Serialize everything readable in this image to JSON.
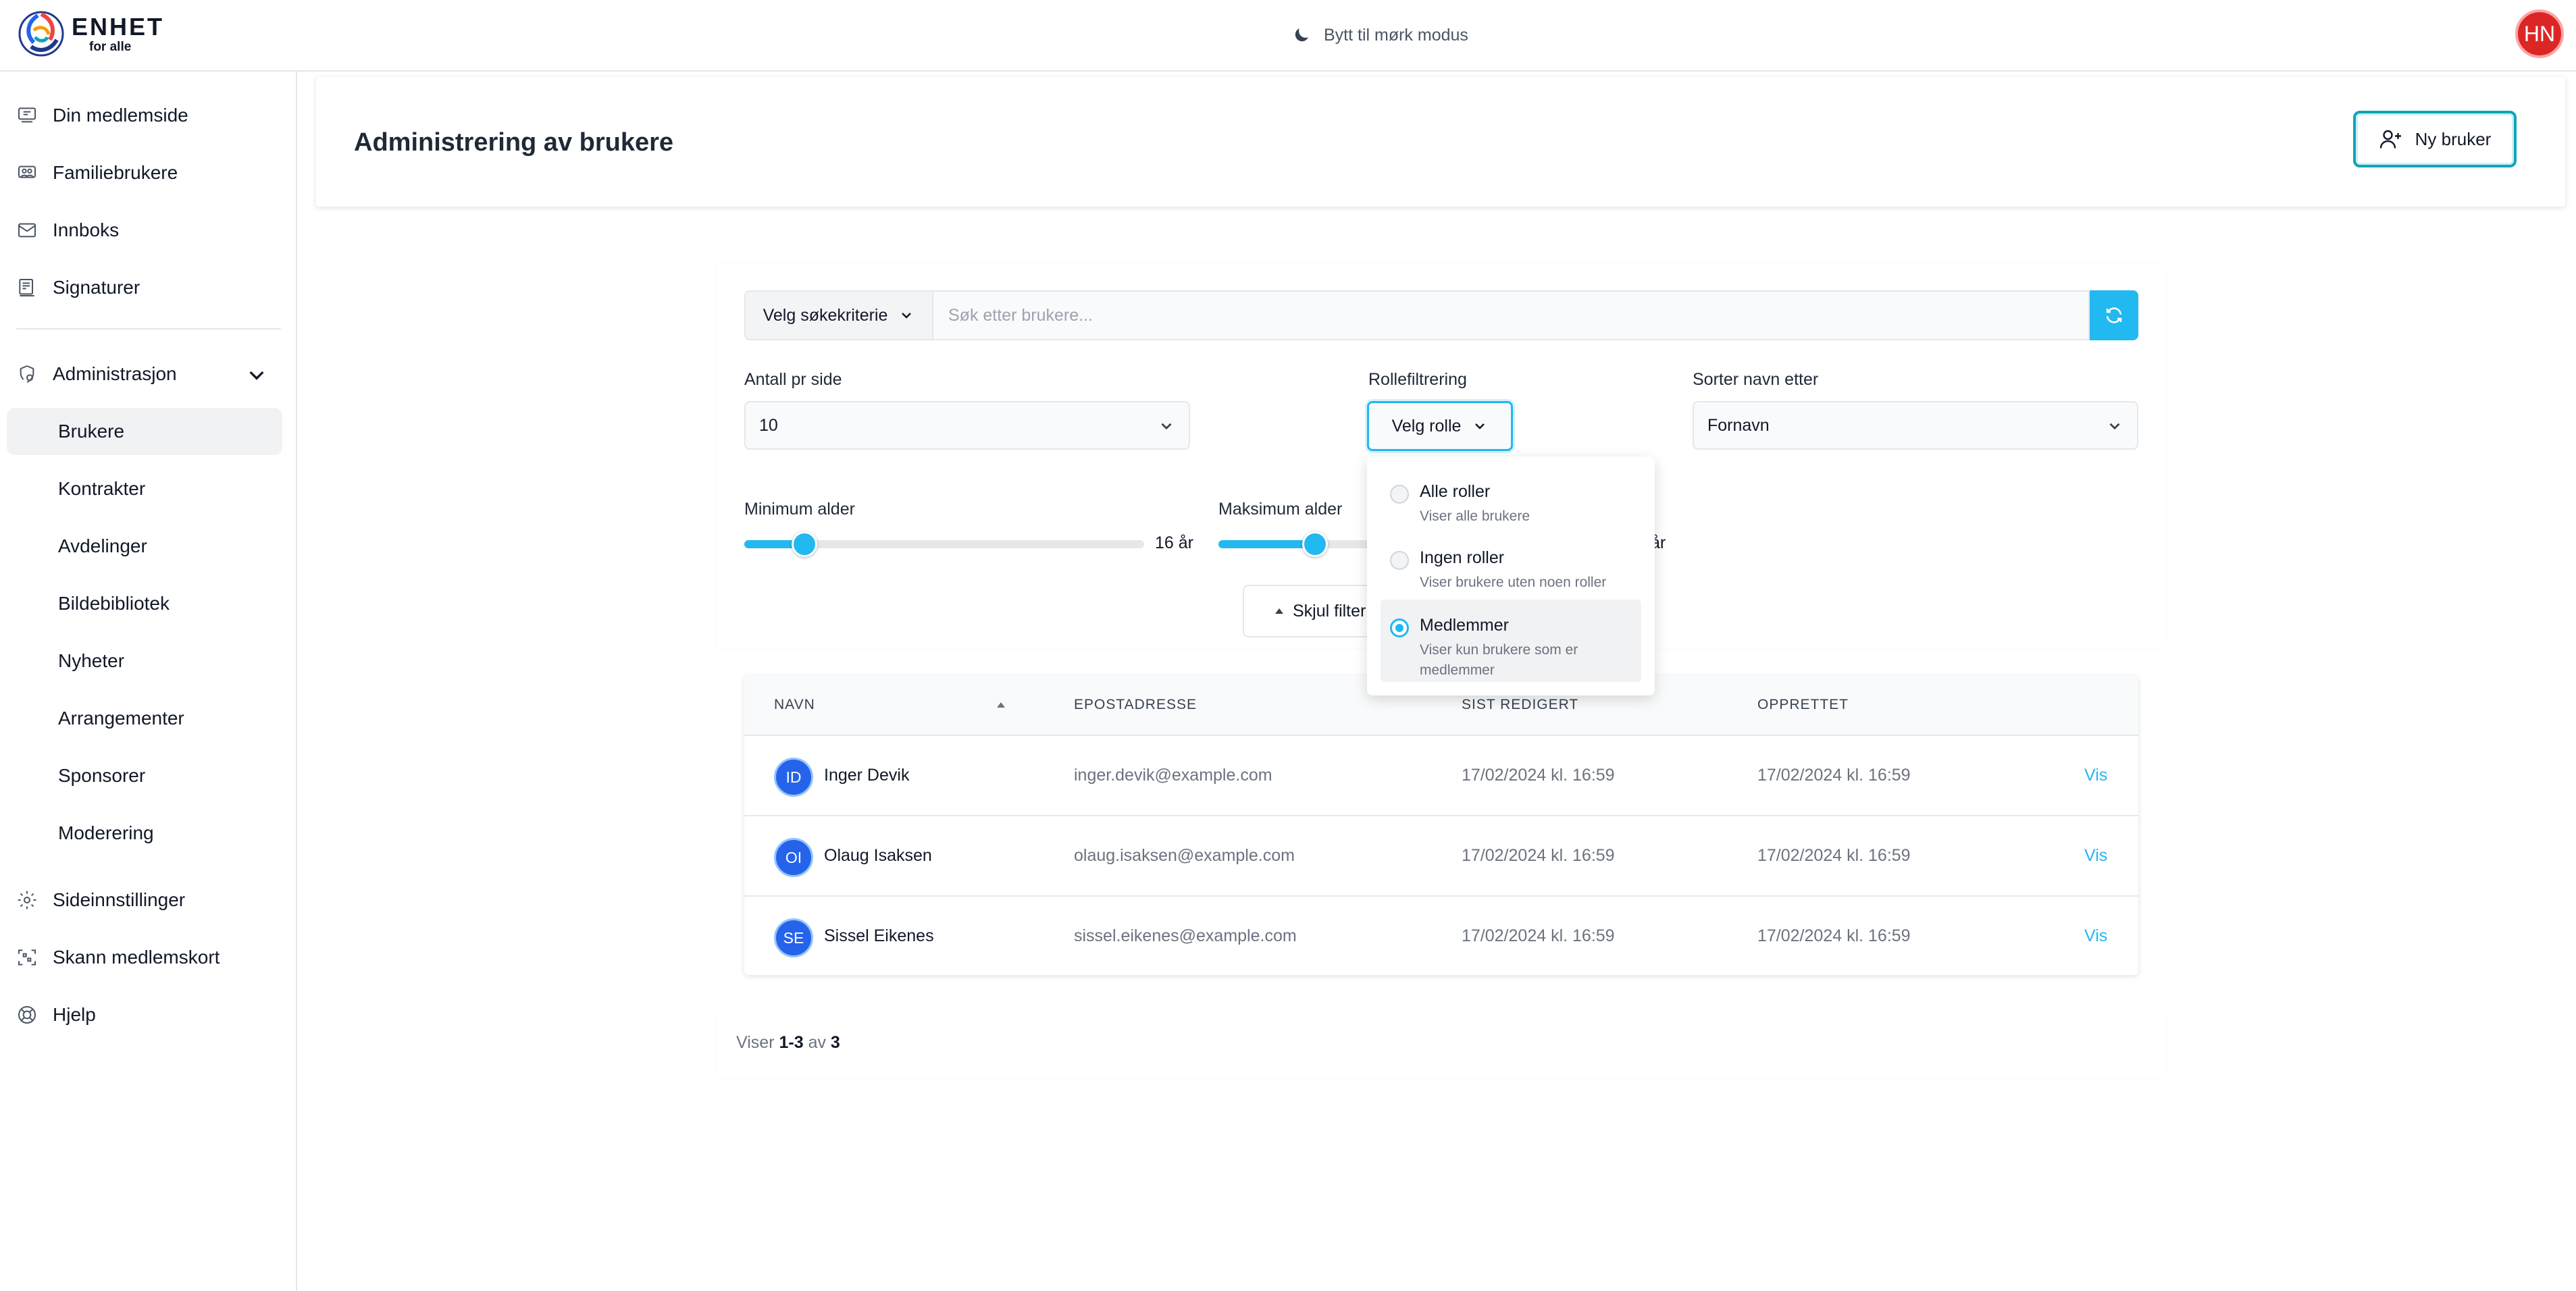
{
  "app": {
    "logo_title": "ENHET",
    "logo_sub": "for alle",
    "theme_toggle_label": "Bytt til mørk modus",
    "user_initials": "HN"
  },
  "sidebar": {
    "items": [
      {
        "label": "Din medlemside",
        "icon": "profile-card-icon"
      },
      {
        "label": "Familiebrukere",
        "icon": "family-icon"
      },
      {
        "label": "Innboks",
        "icon": "mail-icon"
      },
      {
        "label": "Signaturer",
        "icon": "signature-icon"
      }
    ],
    "admin": {
      "label": "Administrasjon",
      "icon": "admin-shield-icon",
      "sub_items": [
        "Brukere",
        "Kontrakter",
        "Avdelinger",
        "Bildebibliotek",
        "Nyheter",
        "Arrangementer",
        "Sponsorer",
        "Moderering"
      ],
      "active": "Brukere"
    },
    "bottom_items": [
      {
        "label": "Sideinnstillinger",
        "icon": "gear-icon"
      },
      {
        "label": "Skann medlemskort",
        "icon": "scan-icon"
      },
      {
        "label": "Hjelp",
        "icon": "lifebuoy-icon"
      }
    ]
  },
  "header": {
    "title": "Administrering av brukere",
    "new_user_button": "Ny bruker"
  },
  "search": {
    "criteria_label": "Velg søkekriterie",
    "placeholder": "Søk etter brukere...",
    "value": ""
  },
  "filters": {
    "per_page_label": "Antall pr side",
    "per_page_value": "10",
    "role_label": "Rollefiltrering",
    "role_button": "Velg rolle",
    "sort_label": "Sorter navn etter",
    "sort_value": "Fornavn",
    "min_age_label": "Minimum alder",
    "min_age_value": "16 år",
    "max_age_label": "Maksimum alder",
    "max_age_value_suffix": "år",
    "hide_filter_label": "Skjul filter"
  },
  "role_dropdown": {
    "options": [
      {
        "title": "Alle roller",
        "desc": "Viser alle brukere",
        "selected": false
      },
      {
        "title": "Ingen roller",
        "desc": "Viser brukere uten noen roller",
        "selected": false
      },
      {
        "title": "Medlemmer",
        "desc": "Viser kun brukere som er medlemmer",
        "selected": true
      }
    ]
  },
  "table": {
    "headers": [
      "NAVN",
      "EPOSTADRESSE",
      "SIST REDIGERT",
      "OPPRETTET"
    ],
    "rows": [
      {
        "initials": "ID",
        "name": "Inger Devik",
        "email": "inger.devik@example.com",
        "edited": "17/02/2024 kl. 16:59",
        "created": "17/02/2024 kl. 16:59",
        "action": "Vis"
      },
      {
        "initials": "OI",
        "name": "Olaug Isaksen",
        "email": "olaug.isaksen@example.com",
        "edited": "17/02/2024 kl. 16:59",
        "created": "17/02/2024 kl. 16:59",
        "action": "Vis"
      },
      {
        "initials": "SE",
        "name": "Sissel Eikenes",
        "email": "sissel.eikenes@example.com",
        "edited": "17/02/2024 kl. 16:59",
        "created": "17/02/2024 kl. 16:59",
        "action": "Vis"
      }
    ]
  },
  "pager": {
    "prefix": "Viser",
    "range": "1-3",
    "of": "av",
    "total": "3"
  },
  "colors": {
    "accent": "#22b8f0",
    "avatar_top": "#dc2626",
    "avatar_row": "#2563eb"
  }
}
